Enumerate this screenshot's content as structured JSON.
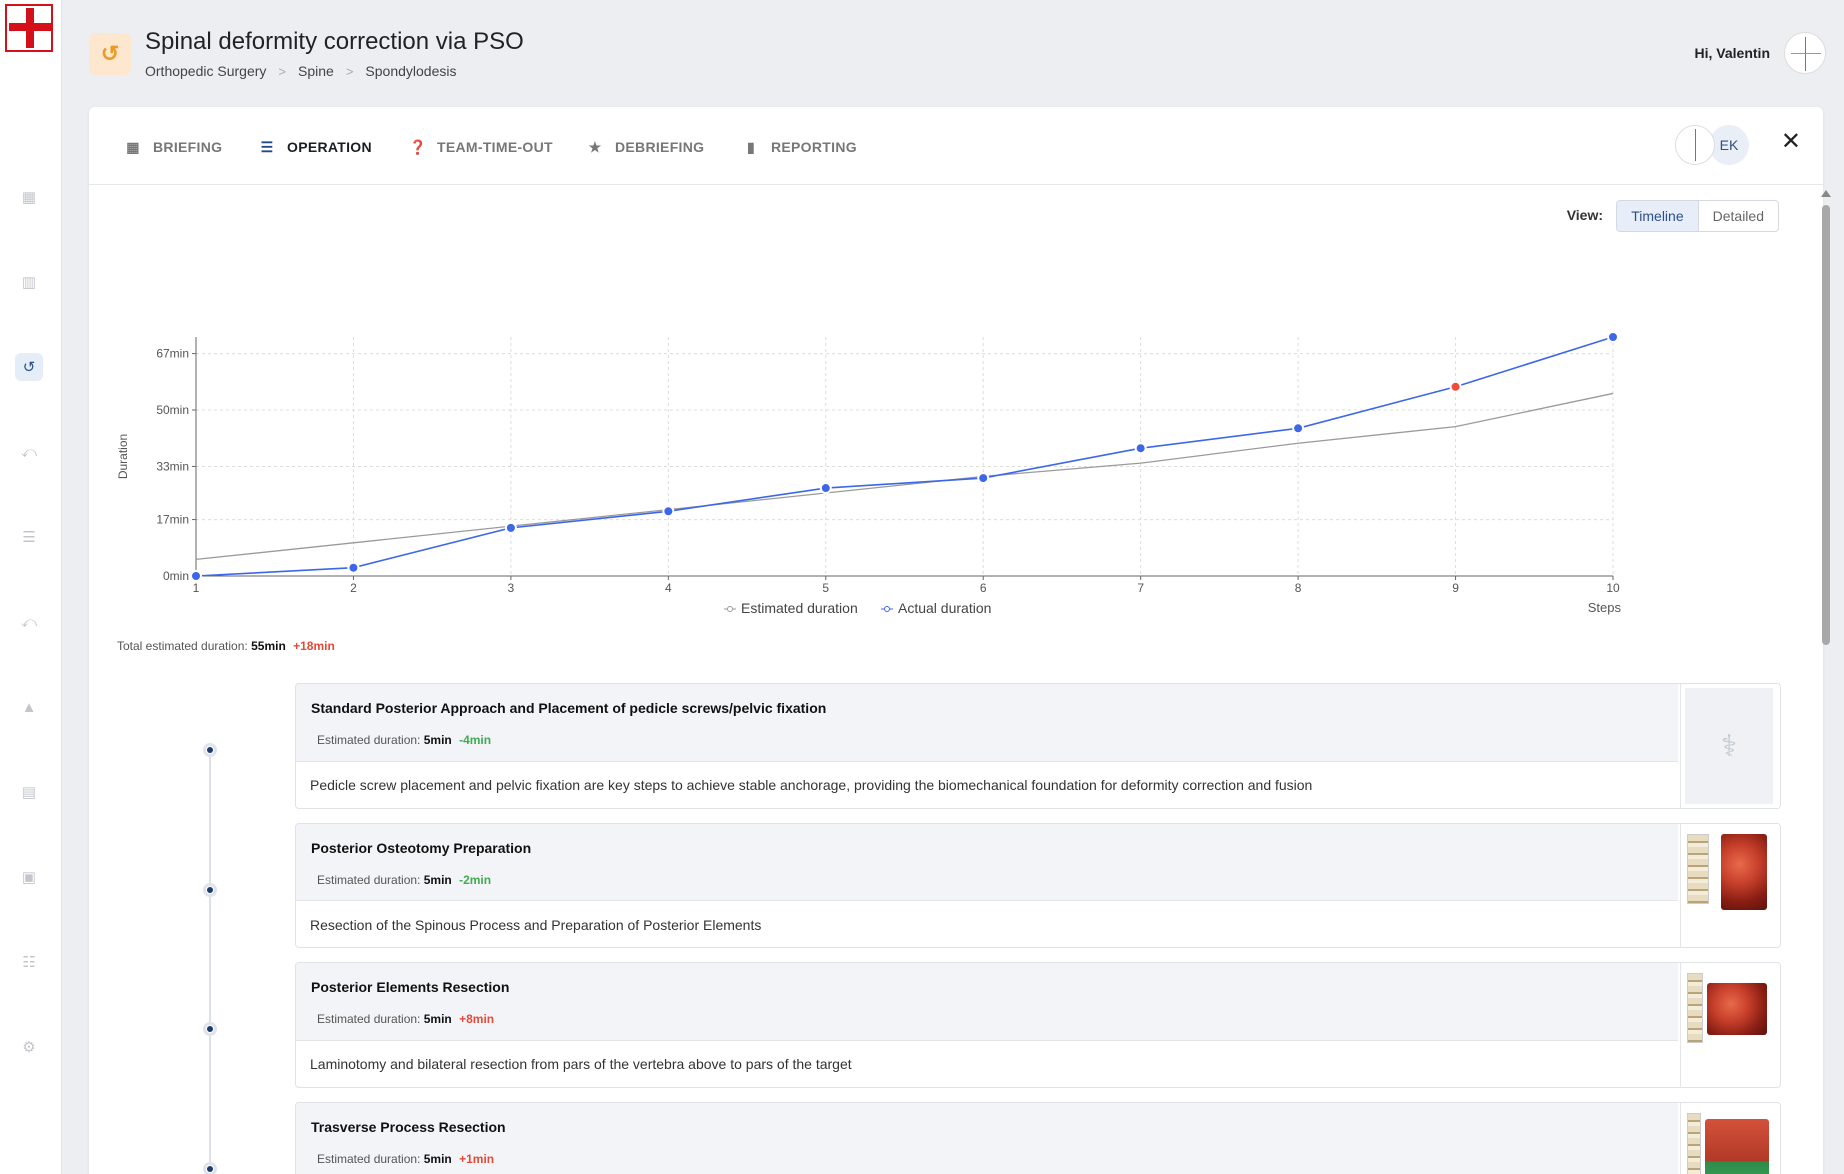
{
  "header": {
    "title": "Spinal deformity correction via PSO",
    "breadcrumb": [
      "Orthopedic Surgery",
      "Spine",
      "Spondylodesis"
    ],
    "greeting": "Hi, Valentin"
  },
  "tabs": [
    {
      "label": "BRIEFING",
      "icon": "grid-icon"
    },
    {
      "label": "OPERATION",
      "icon": "list-icon"
    },
    {
      "label": "TEAM-TIME-OUT",
      "icon": "help-icon"
    },
    {
      "label": "DEBRIEFING",
      "icon": "star-icon"
    },
    {
      "label": "REPORTING",
      "icon": "document-icon"
    }
  ],
  "team": {
    "initials": "EK"
  },
  "view": {
    "label": "View:",
    "options": [
      "Timeline",
      "Detailed"
    ],
    "selected": "Timeline"
  },
  "summary": {
    "label": "Total estimated duration:",
    "value": "55min",
    "delta": "+18min"
  },
  "colors": {
    "actual": "#3c67e8",
    "estimated": "#9a9a9a",
    "over": "#f04b3c",
    "accent": "#2a4f8a"
  },
  "chart_data": {
    "type": "line",
    "xlabel": "Steps",
    "ylabel": "Duration",
    "x": [
      1,
      2,
      3,
      4,
      5,
      6,
      7,
      8,
      9,
      10
    ],
    "y_ticks": [
      "0min",
      "17min",
      "33min",
      "50min",
      "67min"
    ],
    "y_tick_values": [
      0,
      17,
      33,
      50,
      67
    ],
    "ylim": [
      0,
      72
    ],
    "xlim": [
      1,
      10
    ],
    "grid": true,
    "legend": "bottom-center",
    "series": [
      {
        "name": "Estimated duration",
        "values": [
          5,
          10,
          15,
          20,
          25,
          30,
          34,
          40,
          45,
          55
        ]
      },
      {
        "name": "Actual duration",
        "values": [
          0,
          2.5,
          14.5,
          19.5,
          26.5,
          29.5,
          38.5,
          44.5,
          57,
          72
        ],
        "highlight_index": 8
      }
    ]
  },
  "steps": [
    {
      "title": "Standard Posterior Approach and Placement of pedicle screws/pelvic fixation",
      "est_label": "Estimated duration:",
      "est": "5min",
      "delta": "-4min",
      "delta_kind": "minus",
      "desc": "Pedicle screw placement and pelvic fixation are key steps to achieve stable anchorage, providing the biomechanical foundation for deformity correction and fusion"
    },
    {
      "title": "Posterior Osteotomy Preparation",
      "est_label": "Estimated duration:",
      "est": "5min",
      "delta": "-2min",
      "delta_kind": "minus",
      "desc": "Resection of the Spinous Process and Preparation of Posterior Elements"
    },
    {
      "title": "Posterior Elements Resection",
      "est_label": "Estimated duration:",
      "est": "5min",
      "delta": "+8min",
      "delta_kind": "plus",
      "desc": "Laminotomy and bilateral resection from pars of the vertebra above to pars of the target"
    },
    {
      "title": "Trasverse Process Resection",
      "est_label": "Estimated duration:",
      "est": "5min",
      "delta": "+1min",
      "delta_kind": "plus",
      "desc": ""
    }
  ]
}
